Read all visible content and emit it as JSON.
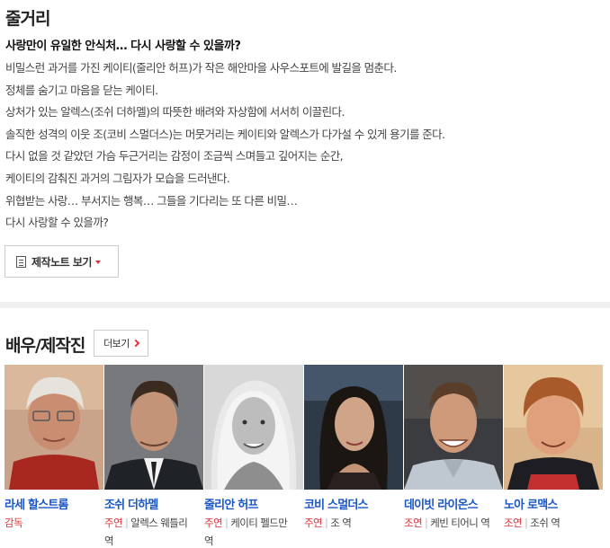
{
  "synopsis": {
    "title": "줄거리",
    "tagline": "사랑만이 유일한 안식처… 다시 사랑할 수 있을까?",
    "lines": [
      "비밀스런 과거를 가진 케이티(줄리안 허프)가 작은 해안마을 사우스포트에 발길을 멈춘다.",
      " 정체를 숨기고 마음을 닫는 케이티.",
      " 상처가 있는 알렉스(조쉬 더하멜)의 따뜻한 배려와 자상함에 서서히 이끌린다.",
      " 솔직한 성격의 이웃 조(코비 스멀더스)는 머뭇거리는 케이티와 알렉스가 다가설 수 있게 용기를 준다.",
      " 다시 없을 것 같았던 가슴 두근거리는 감정이 조금씩 스며들고 깊어지는 순간,",
      " 케이티의 감춰진 과거의 그림자가 모습을 드러낸다.",
      " 위협받는 사랑… 부서지는 행복… 그들을 기다리는 또 다른 비밀…",
      " 다시 사랑할 수 있을까?"
    ],
    "notes_button": "제작노트 보기"
  },
  "cast": {
    "title": "배우/제작진",
    "more_button": "더보기",
    "people": [
      {
        "name": "라세 할스트롬",
        "role_type": "감독",
        "role": ""
      },
      {
        "name": "조쉬 더하멜",
        "role_type": "주연",
        "role": "알렉스 웨틀리 역"
      },
      {
        "name": "줄리안 허프",
        "role_type": "주연",
        "role": "케이티 펠드만 역"
      },
      {
        "name": "코비 스멀더스",
        "role_type": "주연",
        "role": "조 역"
      },
      {
        "name": "데이빗 라이온스",
        "role_type": "조연",
        "role": "케빈 티어니 역"
      },
      {
        "name": "노아 로맥스",
        "role_type": "조연",
        "role": "조쉬 역"
      }
    ]
  },
  "colors": {
    "accent_red": "#e0303a",
    "link_blue": "#1a56c6"
  },
  "icons": [
    "document-icon",
    "caret-down-icon",
    "chevron-right-icon"
  ]
}
